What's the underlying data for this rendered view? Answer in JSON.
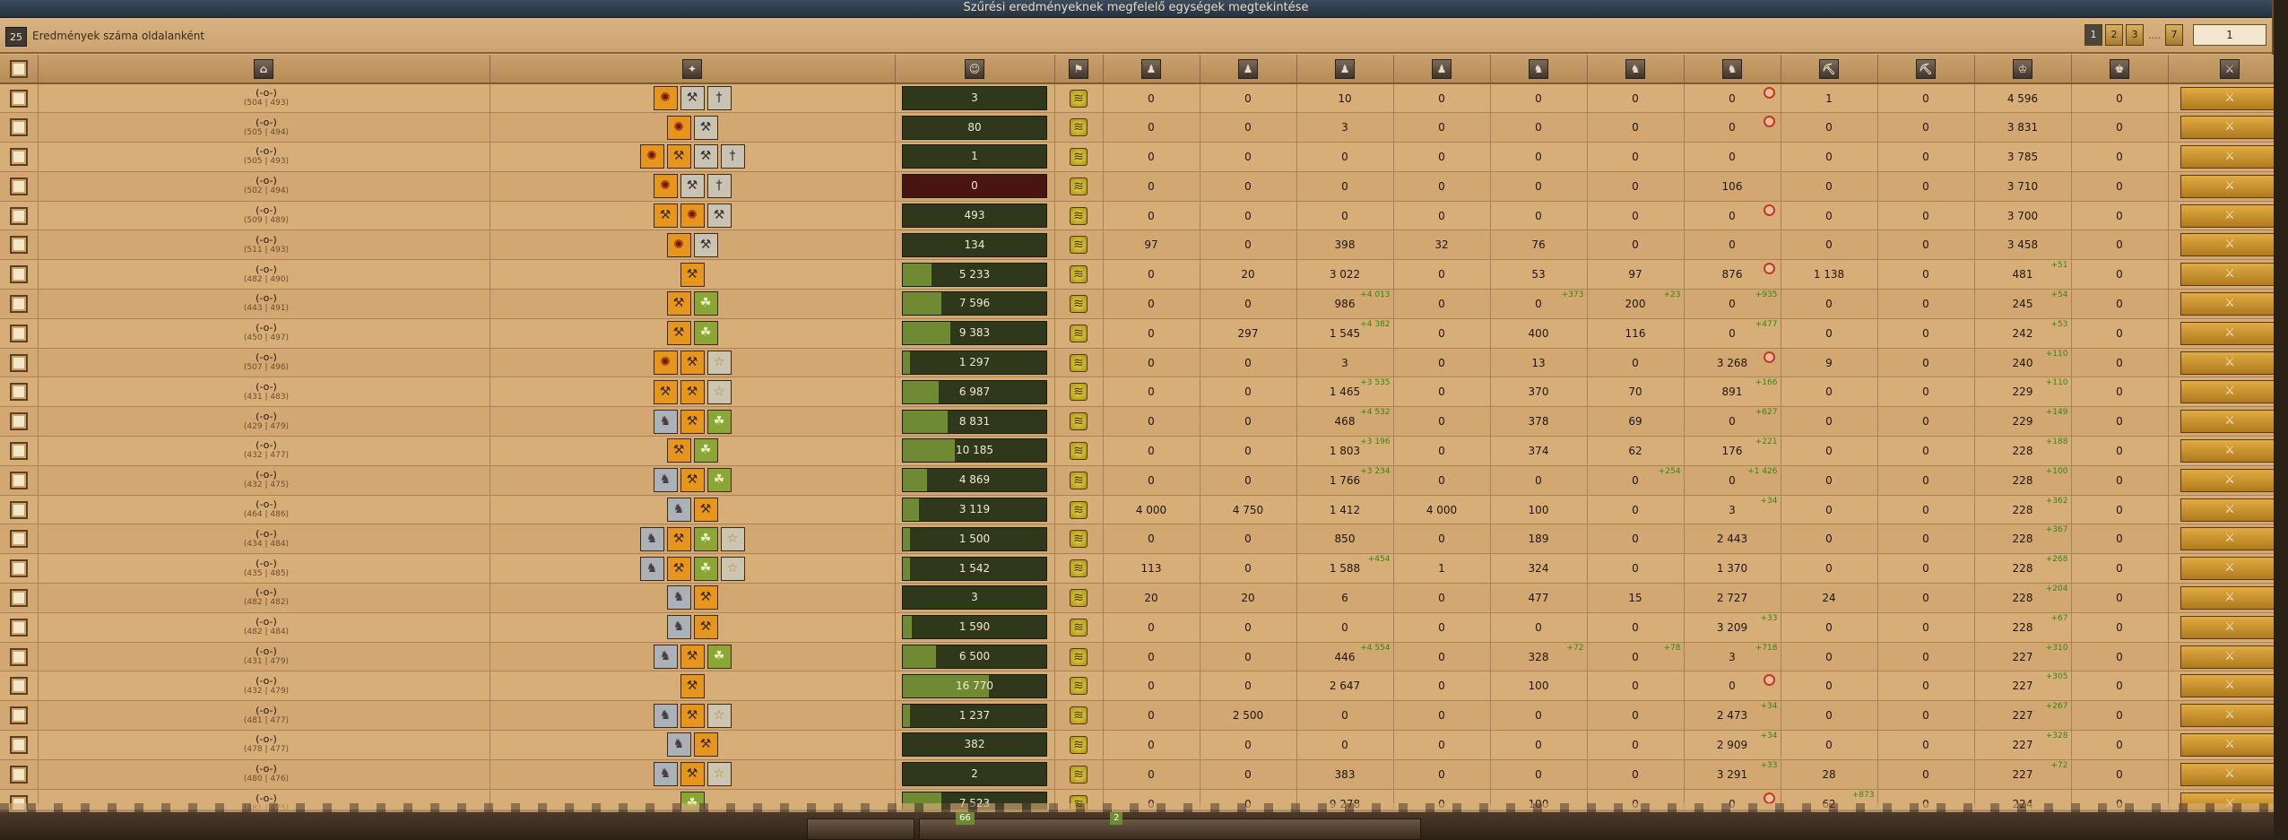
{
  "window": {
    "title": "Szűrési eredményeknek megfelelő egységek megtekintése",
    "per_page_count": "25",
    "per_page_label": "Eredmények száma oldalanként"
  },
  "pagination": {
    "pages": [
      "1",
      "2",
      "3"
    ],
    "ellipsis": "....",
    "last_page": "7",
    "current_value": "1"
  },
  "columns": [
    {
      "name": "select-all",
      "icon": "checkbox"
    },
    {
      "name": "village",
      "icon": "village-icon"
    },
    {
      "name": "effects",
      "icon": "effects-icon"
    },
    {
      "name": "population",
      "icon": "population-icon"
    },
    {
      "name": "morale",
      "icon": "morale-icon"
    },
    {
      "name": "spearman",
      "icon": "spearman-icon"
    },
    {
      "name": "swordsman",
      "icon": "swordsman-icon"
    },
    {
      "name": "axe-fighter",
      "icon": "axe-fighter-icon"
    },
    {
      "name": "archer",
      "icon": "archer-icon"
    },
    {
      "name": "light-cavalry",
      "icon": "light-cavalry-icon"
    },
    {
      "name": "mounted-archer",
      "icon": "mounted-archer-icon"
    },
    {
      "name": "heavy-cavalry",
      "icon": "heavy-cavalry-icon"
    },
    {
      "name": "ram",
      "icon": "ram-icon"
    },
    {
      "name": "catapult",
      "icon": "catapult-icon"
    },
    {
      "name": "knight",
      "icon": "knight-icon"
    },
    {
      "name": "snob",
      "icon": "snob-icon"
    },
    {
      "name": "action",
      "icon": "action-icon"
    }
  ],
  "rows": [
    {
      "name": "(-o-)",
      "coords": "(504 | 493)",
      "effects": [
        "ar",
        "ax",
        "sw"
      ],
      "pop": "3",
      "pop_fill": 0,
      "units": [
        "0",
        "0",
        "10",
        "0",
        "0",
        "0",
        "0",
        "1",
        "0",
        "4 596",
        "0"
      ],
      "inc": {},
      "blocked": [
        6
      ]
    },
    {
      "name": "(-o-)",
      "coords": "(505 | 494)",
      "effects": [
        "ar",
        "ax"
      ],
      "pop": "80",
      "pop_fill": 0,
      "units": [
        "0",
        "0",
        "3",
        "0",
        "0",
        "0",
        "0",
        "0",
        "0",
        "3 831",
        "0"
      ],
      "inc": {},
      "blocked": [
        6
      ]
    },
    {
      "name": "(-o-)",
      "coords": "(505 | 493)",
      "effects": [
        "ar",
        "ma",
        "ax",
        "sw"
      ],
      "pop": "1",
      "pop_fill": 0,
      "units": [
        "0",
        "0",
        "0",
        "0",
        "0",
        "0",
        "0",
        "0",
        "0",
        "3 785",
        "0"
      ],
      "inc": {},
      "blocked": []
    },
    {
      "name": "(-o-)",
      "coords": "(502 | 494)",
      "effects": [
        "ar",
        "ax",
        "sw"
      ],
      "pop": "0",
      "pop_fill": 0,
      "zero": true,
      "units": [
        "0",
        "0",
        "0",
        "0",
        "0",
        "0",
        "106",
        "0",
        "0",
        "3 710",
        "0"
      ],
      "inc": {},
      "blocked": []
    },
    {
      "name": "(-o-)",
      "coords": "(509 | 489)",
      "effects": [
        "ma",
        "ar",
        "ax"
      ],
      "pop": "493",
      "pop_fill": 0,
      "units": [
        "0",
        "0",
        "0",
        "0",
        "0",
        "0",
        "0",
        "0",
        "0",
        "3 700",
        "0"
      ],
      "inc": {},
      "blocked": [
        6
      ]
    },
    {
      "name": "(-o-)",
      "coords": "(511 | 493)",
      "effects": [
        "ar",
        "ax"
      ],
      "pop": "134",
      "pop_fill": 0,
      "units": [
        "97",
        "0",
        "398",
        "32",
        "76",
        "0",
        "0",
        "0",
        "0",
        "3 458",
        "0"
      ],
      "inc": {},
      "blocked": []
    },
    {
      "name": "(-o-)",
      "coords": "(482 | 490)",
      "effects": [
        "ma"
      ],
      "pop": "5 233",
      "pop_fill": 0.2,
      "units": [
        "0",
        "20",
        "3 022",
        "0",
        "53",
        "97",
        "876",
        "1 138",
        "0",
        "481",
        "0"
      ],
      "inc": {
        "9": "+51"
      },
      "blocked": [
        6
      ]
    },
    {
      "name": "(-o-)",
      "coords": "(443 | 491)",
      "effects": [
        "ma",
        "gr"
      ],
      "pop": "7 596",
      "pop_fill": 0.27,
      "units": [
        "0",
        "0",
        "986",
        "0",
        "0",
        "200",
        "0",
        "0",
        "0",
        "245",
        "0"
      ],
      "inc": {
        "2": "+4 013",
        "4": "+373",
        "5": "+23",
        "6": "+935",
        "9": "+54"
      },
      "blocked": []
    },
    {
      "name": "(-o-)",
      "coords": "(450 | 497)",
      "effects": [
        "ma",
        "gr"
      ],
      "pop": "9 383",
      "pop_fill": 0.33,
      "units": [
        "0",
        "297",
        "1 545",
        "0",
        "400",
        "116",
        "0",
        "0",
        "0",
        "242",
        "0"
      ],
      "inc": {
        "2": "+4 382",
        "6": "+477",
        "9": "+53"
      },
      "blocked": []
    },
    {
      "name": "(-o-)",
      "coords": "(507 | 496)",
      "effects": [
        "ar",
        "ma",
        "st"
      ],
      "pop": "1 297",
      "pop_fill": 0.05,
      "units": [
        "0",
        "0",
        "3",
        "0",
        "13",
        "0",
        "3 268",
        "9",
        "0",
        "240",
        "0"
      ],
      "inc": {
        "9": "+110"
      },
      "blocked": [
        6
      ]
    },
    {
      "name": "(-o-)",
      "coords": "(431 | 483)",
      "effects": [
        "ma",
        "ma",
        "st"
      ],
      "pop": "6 987",
      "pop_fill": 0.25,
      "units": [
        "0",
        "0",
        "1 465",
        "0",
        "370",
        "70",
        "891",
        "0",
        "0",
        "229",
        "0"
      ],
      "inc": {
        "2": "+3 535",
        "6": "+166",
        "9": "+110"
      },
      "blocked": []
    },
    {
      "name": "(-o-)",
      "coords": "(429 | 479)",
      "effects": [
        "an",
        "ma",
        "gr"
      ],
      "pop": "8 831",
      "pop_fill": 0.31,
      "units": [
        "0",
        "0",
        "468",
        "0",
        "378",
        "69",
        "0",
        "0",
        "0",
        "229",
        "0"
      ],
      "inc": {
        "2": "+4 532",
        "6": "+627",
        "9": "+149"
      },
      "blocked": []
    },
    {
      "name": "(-o-)",
      "coords": "(432 | 477)",
      "effects": [
        "ma",
        "gr"
      ],
      "pop": "10 185",
      "pop_fill": 0.36,
      "units": [
        "0",
        "0",
        "1 803",
        "0",
        "374",
        "62",
        "176",
        "0",
        "0",
        "228",
        "0"
      ],
      "inc": {
        "2": "+3 196",
        "6": "+221",
        "9": "+188"
      },
      "blocked": []
    },
    {
      "name": "(-o-)",
      "coords": "(432 | 475)",
      "effects": [
        "an",
        "ma",
        "gr"
      ],
      "pop": "4 869",
      "pop_fill": 0.17,
      "units": [
        "0",
        "0",
        "1 766",
        "0",
        "0",
        "0",
        "0",
        "0",
        "0",
        "228",
        "0"
      ],
      "inc": {
        "2": "+3 234",
        "5": "+254",
        "6": "+1 426",
        "9": "+100"
      },
      "blocked": []
    },
    {
      "name": "(-o-)",
      "coords": "(464 | 486)",
      "effects": [
        "an",
        "ma"
      ],
      "pop": "3 119",
      "pop_fill": 0.11,
      "units": [
        "4 000",
        "4 750",
        "1 412",
        "4 000",
        "100",
        "0",
        "3",
        "0",
        "0",
        "228",
        "0"
      ],
      "inc": {
        "6": "+34",
        "9": "+362"
      },
      "blocked": []
    },
    {
      "name": "(-o-)",
      "coords": "(434 | 484)",
      "effects": [
        "an",
        "ma",
        "gr",
        "st"
      ],
      "pop": "1 500",
      "pop_fill": 0.05,
      "units": [
        "0",
        "0",
        "850",
        "0",
        "189",
        "0",
        "2 443",
        "0",
        "0",
        "228",
        "0"
      ],
      "inc": {
        "9": "+367"
      },
      "blocked": []
    },
    {
      "name": "(-o-)",
      "coords": "(435 | 485)",
      "effects": [
        "an",
        "ma",
        "gr",
        "st"
      ],
      "pop": "1 542",
      "pop_fill": 0.05,
      "units": [
        "113",
        "0",
        "1 588",
        "1",
        "324",
        "0",
        "1 370",
        "0",
        "0",
        "228",
        "0"
      ],
      "inc": {
        "2": "+454",
        "9": "+268"
      },
      "blocked": []
    },
    {
      "name": "(-o-)",
      "coords": "(482 | 482)",
      "effects": [
        "an",
        "ma"
      ],
      "pop": "3",
      "pop_fill": 0,
      "units": [
        "20",
        "20",
        "6",
        "0",
        "477",
        "15",
        "2 727",
        "24",
        "0",
        "228",
        "0"
      ],
      "inc": {
        "9": "+204"
      },
      "blocked": []
    },
    {
      "name": "(-o-)",
      "coords": "(482 | 484)",
      "effects": [
        "an",
        "ma"
      ],
      "pop": "1 590",
      "pop_fill": 0.06,
      "units": [
        "0",
        "0",
        "0",
        "0",
        "0",
        "0",
        "3 209",
        "0",
        "0",
        "228",
        "0"
      ],
      "inc": {
        "6": "+33",
        "9": "+67"
      },
      "blocked": []
    },
    {
      "name": "(-o-)",
      "coords": "(431 | 479)",
      "effects": [
        "an",
        "ma",
        "gr"
      ],
      "pop": "6 500",
      "pop_fill": 0.23,
      "units": [
        "0",
        "0",
        "446",
        "0",
        "328",
        "0",
        "3",
        "0",
        "0",
        "227",
        "0"
      ],
      "inc": {
        "2": "+4 554",
        "4": "+72",
        "5": "+78",
        "6": "+718",
        "9": "+310"
      },
      "blocked": []
    },
    {
      "name": "(-o-)",
      "coords": "(432 | 479)",
      "effects": [
        "ma"
      ],
      "pop": "16 770",
      "pop_fill": 0.6,
      "units": [
        "0",
        "0",
        "2 647",
        "0",
        "100",
        "0",
        "0",
        "0",
        "0",
        "227",
        "0"
      ],
      "inc": {
        "9": "+305"
      },
      "blocked": [
        6
      ]
    },
    {
      "name": "(-o-)",
      "coords": "(481 | 477)",
      "effects": [
        "an",
        "ma",
        "st"
      ],
      "pop": "1 237",
      "pop_fill": 0.05,
      "units": [
        "0",
        "2 500",
        "0",
        "0",
        "0",
        "0",
        "2 473",
        "0",
        "0",
        "227",
        "0"
      ],
      "inc": {
        "6": "+34",
        "9": "+267"
      },
      "blocked": []
    },
    {
      "name": "(-o-)",
      "coords": "(478 | 477)",
      "effects": [
        "an",
        "ma"
      ],
      "pop": "382",
      "pop_fill": 0,
      "units": [
        "0",
        "0",
        "0",
        "0",
        "0",
        "0",
        "2 909",
        "0",
        "0",
        "227",
        "0"
      ],
      "inc": {
        "6": "+34",
        "9": "+328"
      },
      "blocked": []
    },
    {
      "name": "(-o-)",
      "coords": "(480 | 476)",
      "effects": [
        "an",
        "ma",
        "st"
      ],
      "pop": "2",
      "pop_fill": 0,
      "units": [
        "0",
        "0",
        "383",
        "0",
        "0",
        "0",
        "3 291",
        "28",
        "0",
        "227",
        "0"
      ],
      "inc": {
        "6": "+33",
        "9": "+72"
      },
      "blocked": []
    },
    {
      "name": "(-o-)",
      "coords": "(481 | 475)",
      "effects": [
        "gr"
      ],
      "pop": "7 523",
      "pop_fill": 0.27,
      "units": [
        "0",
        "0",
        "9 278",
        "0",
        "100",
        "0",
        "0",
        "62",
        "0",
        "224",
        "0"
      ],
      "inc": {
        "7": "+873"
      },
      "blocked": [
        6
      ]
    }
  ],
  "effect_glyphs": {
    "ar": "✺",
    "ax": "⚒",
    "sw": "†",
    "ma": "⚒",
    "gr": "☘",
    "st": "☆",
    "an": "♞"
  },
  "colors": {
    "accent": "#e0ac42",
    "positive": "#2f8a0f",
    "danger": "#c23a1e"
  },
  "footer": {
    "left_badge": "66",
    "right_badge": "2"
  }
}
